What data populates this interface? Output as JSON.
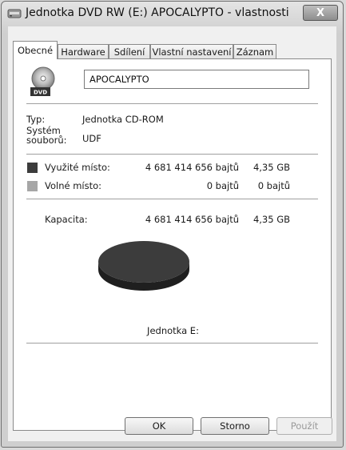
{
  "window": {
    "title": "Jednotka DVD RW (E:) APOCALYPTO - vlastnosti",
    "close_label": "X"
  },
  "tabs": [
    {
      "label": "Obecné"
    },
    {
      "label": "Hardware"
    },
    {
      "label": "Sdílení"
    },
    {
      "label": "Vlastní nastavení"
    },
    {
      "label": "Záznam"
    }
  ],
  "general": {
    "volume_name": "APOCALYPTO",
    "drive_icon_label": "DVD",
    "type_label": "Typ:",
    "type_value": "Jednotka CD-ROM",
    "fs_label_line1": "Systém",
    "fs_label_line2": "souborů:",
    "fs_value": "UDF",
    "used_label": "Využité místo:",
    "used_bytes": "4 681 414 656 bajtů",
    "used_size": "4,35 GB",
    "free_label": "Volné místo:",
    "free_bytes": "0 bajtů",
    "free_size": "0 bajtů",
    "capacity_label": "Kapacita:",
    "capacity_bytes": "4 681 414 656 bajtů",
    "capacity_size": "4,35 GB",
    "drive_label": "Jednotka E:"
  },
  "usage": {
    "used_fraction": 1.0,
    "used_color": "#3c3c3c",
    "free_color": "#a6a6a6"
  },
  "buttons": {
    "ok": "OK",
    "cancel": "Storno",
    "apply": "Použít"
  }
}
